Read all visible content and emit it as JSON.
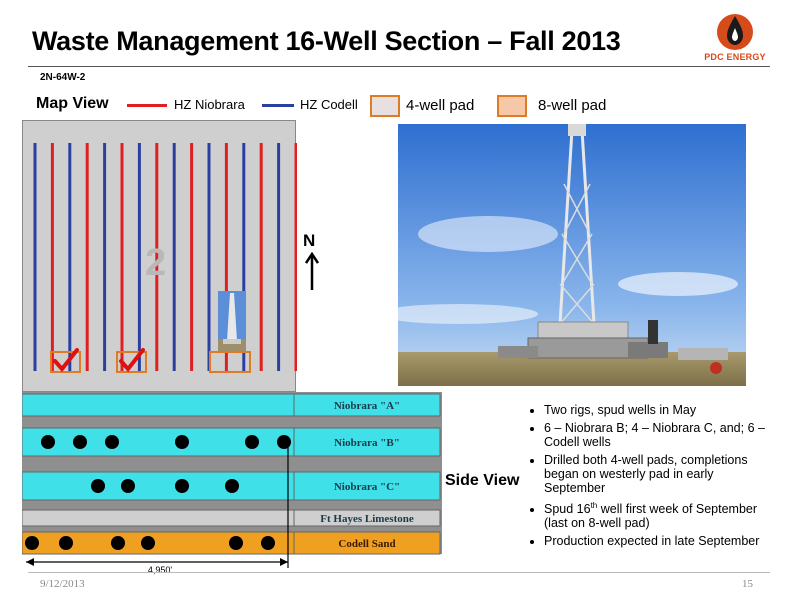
{
  "header": {
    "title": "Waste Management 16-Well Section – Fall 2013",
    "subtitle": "2N-64W-2",
    "logo_text": "PDC ENERGY"
  },
  "legend": {
    "map_view": "Map View",
    "niobrara": "HZ Niobrara",
    "codell": "HZ Codell",
    "pad4": "4-well pad",
    "pad8": "8-well pad"
  },
  "map": {
    "section_number": "2",
    "north": "N",
    "well_colors": [
      "#2b3fa0",
      "#e02020"
    ],
    "well_sequence": [
      "codell",
      "niobrara",
      "codell",
      "niobrara",
      "codell",
      "niobrara",
      "codell",
      "niobrara",
      "codell",
      "niobrara",
      "codell",
      "niobrara",
      "codell",
      "niobrara",
      "codell",
      "niobrara"
    ],
    "pads": [
      {
        "type": "4-well pad",
        "status": "drilled"
      },
      {
        "type": "4-well pad",
        "status": "drilled"
      },
      {
        "type": "8-well pad",
        "status": "drilling"
      }
    ]
  },
  "side_view": {
    "label": "Side View",
    "distance_label": "4,950'",
    "layers": [
      {
        "name": "Niobrara \"A\"",
        "wells": 0
      },
      {
        "name": "Niobrara \"B\"",
        "wells": 6
      },
      {
        "name": "Niobrara \"C\"",
        "wells": 4
      },
      {
        "name": "Ft Hayes Limestone",
        "wells": 0
      },
      {
        "name": "Codell Sand",
        "wells": 6
      }
    ]
  },
  "bullets": [
    "Two rigs, spud wells in May",
    "6 – Niobrara B; 4 – Niobrara C, and; 6 – Codell wells",
    "Drilled both 4-well pads, completions began on westerly pad in early September",
    "Spud 16th well first week of September (last on 8-well pad)",
    "Production expected in late September"
  ],
  "footer": {
    "date": "9/12/2013",
    "page": "15"
  },
  "colors": {
    "niobrara": "#e02020",
    "codell": "#2b3fa0",
    "pad_outline": "#e07b25",
    "logo_orange": "#d64b1a",
    "cyan_layer": "#3fe0e8",
    "codell_layer": "#f0a020"
  }
}
